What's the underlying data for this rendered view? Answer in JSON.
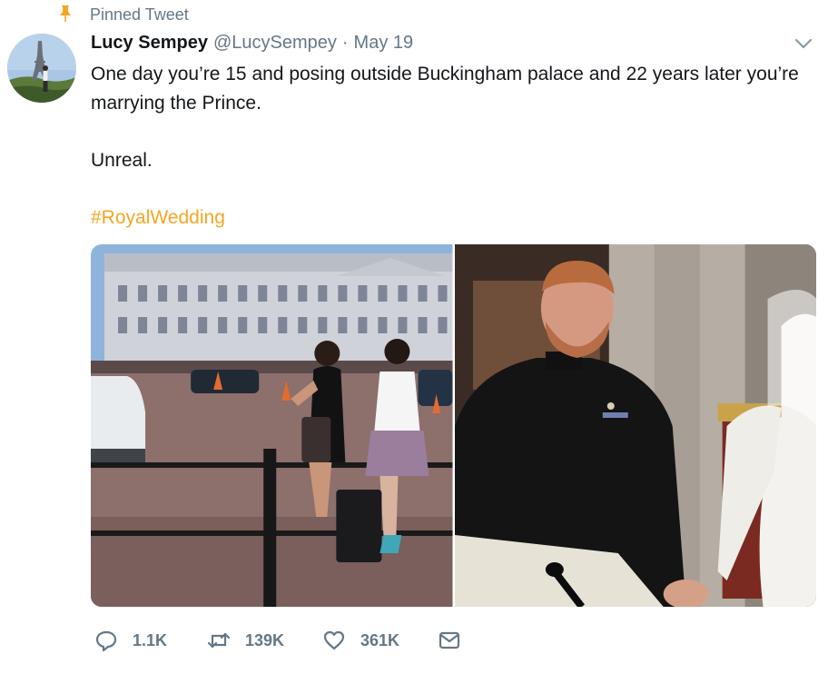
{
  "pinned": {
    "label": "Pinned Tweet",
    "icon": "pin-icon",
    "color": "#f5a623"
  },
  "tweet": {
    "author_name": "Lucy Sempey",
    "author_handle": "@LucySempey",
    "separator": "·",
    "date": "May 19",
    "text_line1": "One day you’re 15 and posing outside Buckingham palace and 22 years later you’re marrying the Prince.",
    "text_line2": "Unreal.",
    "hashtag": "#RoyalWedding",
    "hashtag_color": "#f5a623"
  },
  "media": {
    "left_image": "photo-buckingham-palace",
    "right_image": "photo-royal-wedding"
  },
  "actions": {
    "reply": {
      "icon": "reply-icon",
      "count": "1.1K"
    },
    "retweet": {
      "icon": "retweet-icon",
      "count": "139K"
    },
    "like": {
      "icon": "heart-icon",
      "count": "361K"
    },
    "dm": {
      "icon": "envelope-icon"
    }
  },
  "colors": {
    "secondary_text": "#657786",
    "primary_text": "#14171a"
  }
}
